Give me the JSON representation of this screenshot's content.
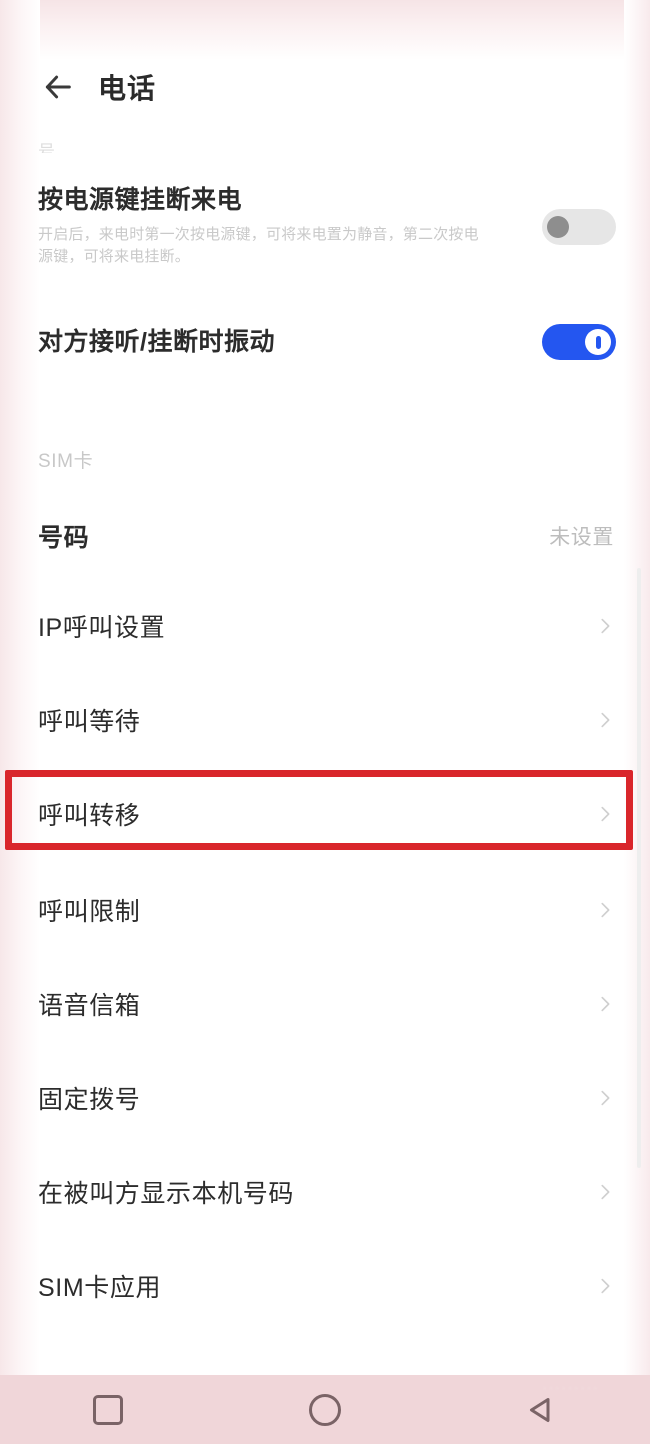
{
  "header": {
    "back_icon": "back-arrow-icon",
    "title": "电话"
  },
  "ghost_label": "号",
  "switches": [
    {
      "title": "按电源键挂断来电",
      "description": "开启后，来电时第一次按电源键，可将来电置为静音，第二次按电源键，可将来电挂断。",
      "state": "off"
    },
    {
      "title": "对方接听/挂断时振动",
      "description": "",
      "state": "on"
    }
  ],
  "section": {
    "header": "SIM卡"
  },
  "rows": [
    {
      "label": "号码",
      "value": "未设置",
      "chevron": false,
      "bold": true
    },
    {
      "label": "IP呼叫设置",
      "value": "",
      "chevron": true,
      "bold": false
    },
    {
      "label": "呼叫等待",
      "value": "",
      "chevron": true,
      "bold": false
    },
    {
      "label": "呼叫转移",
      "value": "",
      "chevron": true,
      "bold": false
    },
    {
      "label": "呼叫限制",
      "value": "",
      "chevron": true,
      "bold": false
    },
    {
      "label": "语音信箱",
      "value": "",
      "chevron": true,
      "bold": false
    },
    {
      "label": "固定拨号",
      "value": "",
      "chevron": true,
      "bold": false
    },
    {
      "label": "在被叫方显示本机号码",
      "value": "",
      "chevron": true,
      "bold": false
    },
    {
      "label": "SIM卡应用",
      "value": "",
      "chevron": true,
      "bold": false
    }
  ],
  "highlight": {
    "target_label": "呼叫转移",
    "color": "#d9262b"
  },
  "navbar": {
    "recents_icon": "square-recents-icon",
    "home_icon": "circle-home-icon",
    "back_icon": "triangle-back-icon"
  },
  "watermark": {
    "text": "·········"
  },
  "colors": {
    "accent_on": "#2456f0",
    "highlight": "#d9262b",
    "navbar_bg": "#f0d6d9",
    "text_primary": "#2c2c2c",
    "text_muted": "#c8c8c8"
  }
}
